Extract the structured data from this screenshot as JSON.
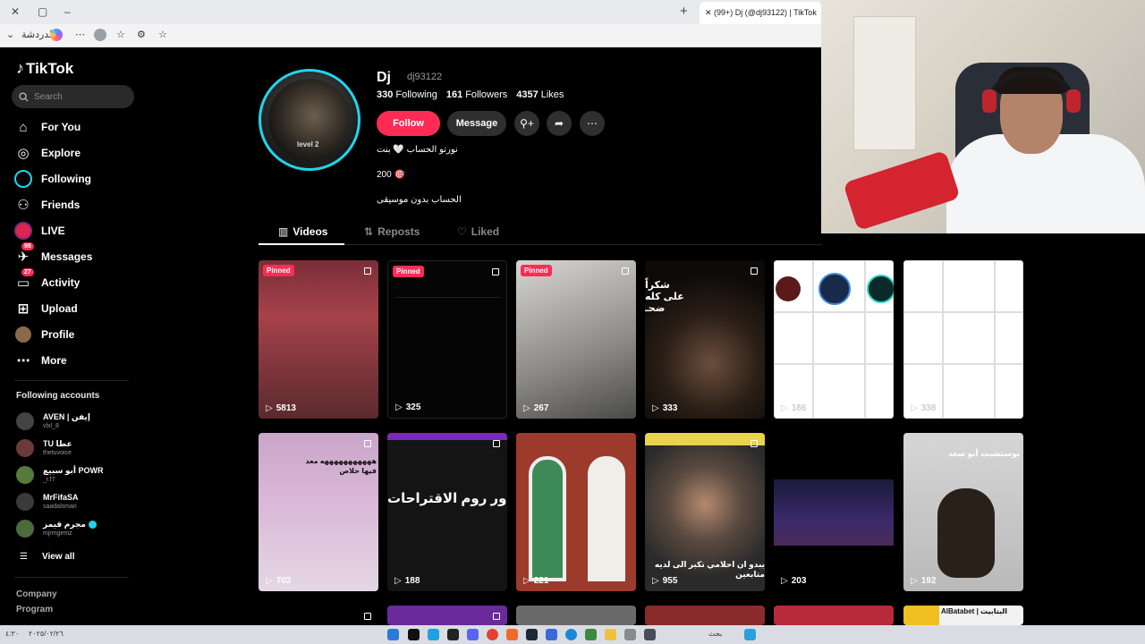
{
  "browser": {
    "tab_title": "(99+) Dj (@dj93122) | TikTok",
    "toolbar_label": "الدردشة",
    "new_tab": "+"
  },
  "sidebar": {
    "logo": "TikTok",
    "search_placeholder": "Search",
    "nav": [
      {
        "label": "For You",
        "icon": "home-icon"
      },
      {
        "label": "Explore",
        "icon": "compass-icon"
      },
      {
        "label": "Following",
        "icon": "following-ring-icon"
      },
      {
        "label": "Friends",
        "icon": "friends-icon"
      },
      {
        "label": "LIVE",
        "icon": "live-icon"
      },
      {
        "label": "Messages",
        "icon": "messages-icon",
        "badge": "98"
      },
      {
        "label": "Activity",
        "icon": "activity-icon",
        "badge": "27"
      },
      {
        "label": "Upload",
        "icon": "upload-icon"
      },
      {
        "label": "Profile",
        "icon": "profile-icon"
      },
      {
        "label": "More",
        "icon": "more-icon"
      }
    ],
    "following_title": "Following accounts",
    "accounts": [
      {
        "name": "AVEN | إيفن",
        "handle": "vlxl_8",
        "color": "#444"
      },
      {
        "name": "TU عطا",
        "handle": "thetuvoice",
        "color": "#6b3a3a"
      },
      {
        "name": "أبو سبيع POWR",
        "handle": "_r.f7",
        "color": "#557a3a"
      },
      {
        "name": "MrFifaSA",
        "handle": "saadalsmari",
        "color": "#3a3a3a"
      },
      {
        "name": "مجرم قيمز",
        "handle": "mjrmgemz",
        "color": "#4b6b3a",
        "verified": true
      }
    ],
    "view_all": "View all",
    "footer": [
      "Company",
      "Program"
    ]
  },
  "profile": {
    "name": "Dj",
    "handle": "dj93122",
    "following_count": "330",
    "following_label": "Following",
    "followers_count": "161",
    "followers_label": "Followers",
    "likes_count": "4357",
    "likes_label": "Likes",
    "follow_button": "Follow",
    "message_button": "Message",
    "avatar_text": "level 2",
    "bio_line1": "نورتو الحساب 🤍 بنت",
    "bio_line2": "200 🎯",
    "bio_line3": "الحساب بدون موسيقى"
  },
  "tabs": [
    {
      "label": "Videos",
      "icon": "grid-icon",
      "active": true
    },
    {
      "label": "Reposts",
      "icon": "repost-icon",
      "active": false
    },
    {
      "label": "Liked",
      "icon": "liked-icon",
      "active": false
    }
  ],
  "videos": [
    {
      "views": "5813",
      "pinned": "Pinned",
      "multi": true
    },
    {
      "views": "325",
      "pinned": "Pinned",
      "multi": true
    },
    {
      "views": "267",
      "pinned": "Pinned",
      "multi": true
    },
    {
      "views": "333",
      "multi": true,
      "overlay": "شكراً على كله ضحـ"
    },
    {
      "views": "186"
    },
    {
      "views": "338"
    },
    {
      "views": "702",
      "multi": true,
      "overlay": "هههههههههههه معد فيها خلاص"
    },
    {
      "views": "188",
      "multi": true,
      "overlay": "ور روم الاقتراحات"
    },
    {
      "views": "221"
    },
    {
      "views": "955",
      "multi": true,
      "overlay": "يبدو ان احلامي تكبر الى لديه متابعين"
    },
    {
      "views": "203"
    },
    {
      "views": "192",
      "overlay": "بوستشيت أبو سعد"
    }
  ],
  "bottom_row_text": "AlBatabet | البتابيت",
  "taskbar": {
    "time": "٤:٣٠",
    "date": "٢٠٢٥/٠٢/٢٦",
    "search": "بحث"
  }
}
